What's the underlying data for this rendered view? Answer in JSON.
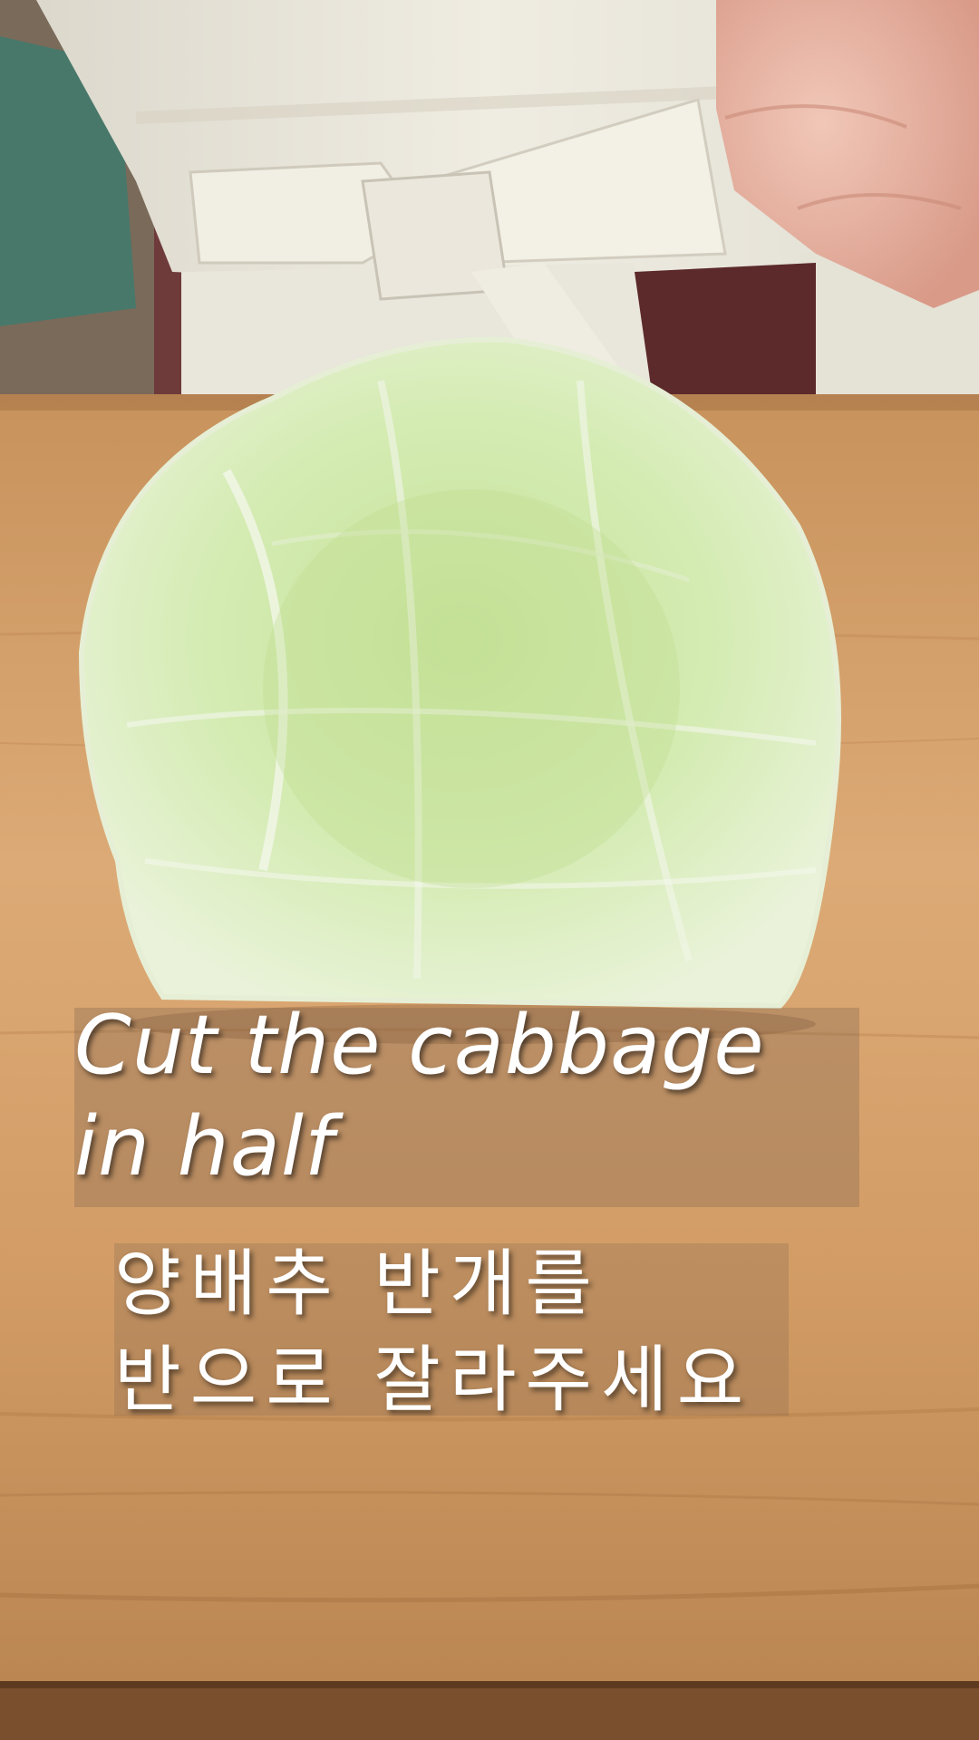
{
  "caption": {
    "english_line1": "Cut the cabbage",
    "english_line2": "in half",
    "korean_line1": "양배추 반개를",
    "korean_line2": "반으로 잘라주세요"
  },
  "colors": {
    "board": "#d9a672",
    "board_dark": "#b98552",
    "cabbage": "#cfe6a6",
    "apron": "#ece9de",
    "caption_text": "#ffffff"
  }
}
